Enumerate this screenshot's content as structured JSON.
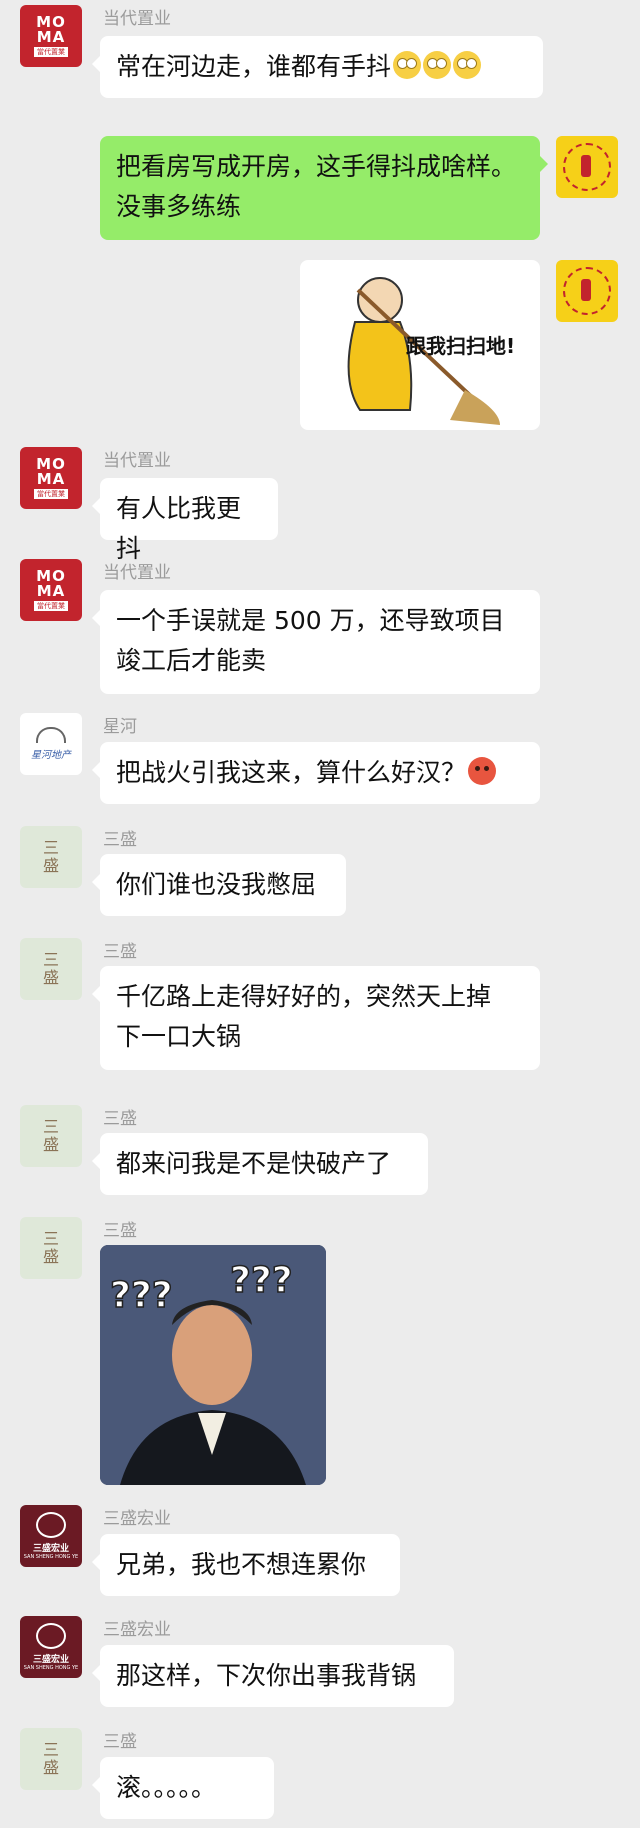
{
  "messages": [
    {
      "sender": "当代置业",
      "text": "常在河边走，谁都有手抖"
    },
    {
      "text": "把看房写成开房，这手得抖成啥样。没事多练练",
      "line1": "把看房写成开房，这手得抖成啥样。",
      "line2": "没事多练练"
    },
    {
      "sticker_text": "跟我扫扫地!"
    },
    {
      "sender": "当代置业",
      "text": "有人比我更抖"
    },
    {
      "sender": "当代置业",
      "line1": "一个手误就是 500 万，还导致项目",
      "line2": "竣工后才能卖"
    },
    {
      "sender": "星河",
      "text": "把战火引我这来，算什么好汉？"
    },
    {
      "sender": "三盛",
      "text": "你们谁也没我憋屈"
    },
    {
      "sender": "三盛",
      "line1": "千亿路上走得好好的，突然天上掉",
      "line2": "下一口大锅"
    },
    {
      "sender": "三盛",
      "text": "都来问我是不是快破产了"
    },
    {
      "sender": "三盛",
      "photo_marks": "???"
    },
    {
      "sender": "三盛宏业",
      "text": "兄弟，我也不想连累你"
    },
    {
      "sender": "三盛宏业",
      "text": "那这样，下次你出事我背锅"
    },
    {
      "sender": "三盛",
      "text": "滚。。。。。"
    }
  ],
  "avatars": {
    "moma": {
      "line1": "MO",
      "line2": "MA",
      "sub": "當代置業"
    },
    "xinghe": {
      "label": "星河地产"
    },
    "sansheng": {
      "line1": "三",
      "line2": "盛"
    },
    "hongye": {
      "label": "三盛宏业",
      "sub": "SAN SHENG HONG YE"
    }
  },
  "colors": {
    "background": "#ececec",
    "incoming": "#ffffff",
    "outgoing": "#95ec69"
  }
}
